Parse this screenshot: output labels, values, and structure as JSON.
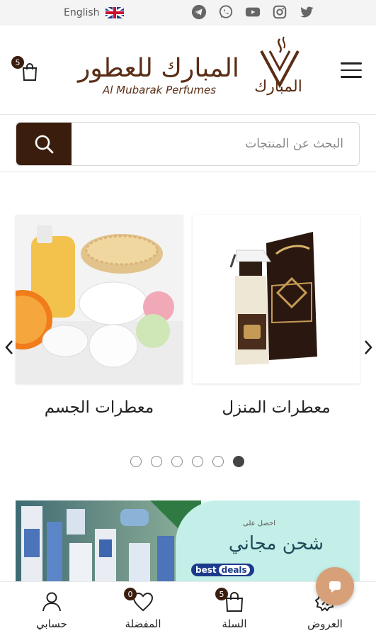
{
  "topbar": {
    "language": "English",
    "flag_icon": "uk-flag-icon",
    "socials": [
      "telegram-icon",
      "whatsapp-icon",
      "youtube-icon",
      "instagram-icon",
      "twitter-icon",
      "facebook-icon"
    ]
  },
  "header": {
    "cart_count": "5",
    "brand_arabic": "المبارك للعطور",
    "brand_english": "Al Mubarak Perfumes",
    "logo_arabic": "المبارك",
    "menu_icon": "hamburger-menu-icon"
  },
  "search": {
    "placeholder": "البحث عن المنتجات",
    "button_icon": "search-icon"
  },
  "categories": {
    "items": [
      {
        "title": "معطرات المنزل",
        "image": "home-fresheners-image"
      },
      {
        "title": "معطرات الجسم",
        "image": "body-fresheners-image"
      }
    ],
    "dots_total": 6,
    "active_dot": 6
  },
  "banner": {
    "small_text": "احصل على",
    "big_text": "شحن مجاني",
    "logo_text_1": "best",
    "logo_text_2": "deals"
  },
  "bottom_nav": {
    "items": [
      {
        "label": "حسابي",
        "icon": "user-icon"
      },
      {
        "label": "المفضلة",
        "icon": "heart-icon",
        "badge": "0"
      },
      {
        "label": "السلة",
        "icon": "bag-icon",
        "badge": "5"
      },
      {
        "label": "العروض",
        "icon": "offers-icon"
      }
    ]
  },
  "colors": {
    "brand": "#3b1d0e",
    "brand_text": "#5a2d14",
    "chat": "#d7a079"
  }
}
